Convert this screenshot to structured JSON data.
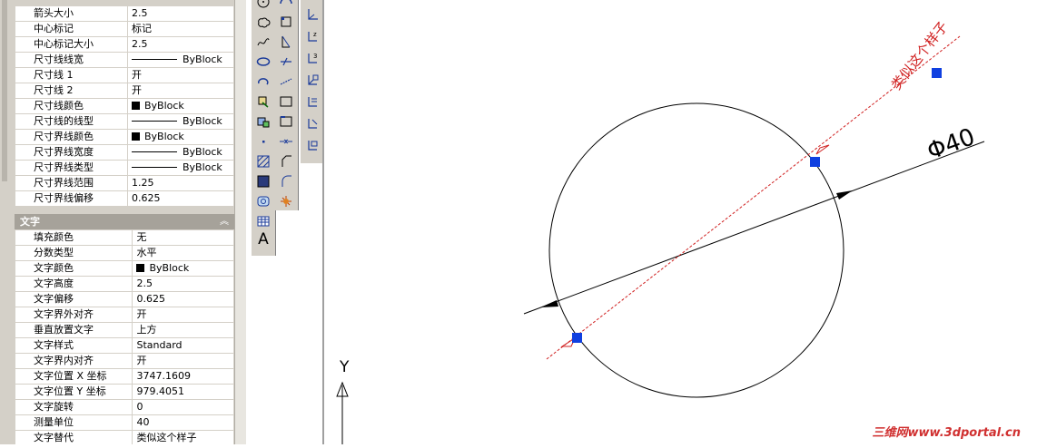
{
  "properties": {
    "group1_rows": [
      {
        "label": "箭头大小",
        "value": "2.5"
      },
      {
        "label": "中心标记",
        "value": "标记"
      },
      {
        "label": "中心标记大小",
        "value": "2.5"
      },
      {
        "label": "尺寸线线宽",
        "value": "ByBlock",
        "kind": "line"
      },
      {
        "label": "尺寸线 1",
        "value": "开"
      },
      {
        "label": "尺寸线 2",
        "value": "开"
      },
      {
        "label": "尺寸线颜色",
        "value": "ByBlock",
        "kind": "swatch"
      },
      {
        "label": "尺寸线的线型",
        "value": "ByBlock",
        "kind": "line"
      },
      {
        "label": "尺寸界线颜色",
        "value": "ByBlock",
        "kind": "swatch"
      },
      {
        "label": "尺寸界线宽度",
        "value": "ByBlock",
        "kind": "line"
      },
      {
        "label": "尺寸界线类型",
        "value": "ByBlock",
        "kind": "line"
      },
      {
        "label": "尺寸界线范围",
        "value": "1.25"
      },
      {
        "label": "尺寸界线偏移",
        "value": "0.625"
      }
    ],
    "text_section_title": "文字",
    "text_rows": [
      {
        "label": "填充颜色",
        "value": "无"
      },
      {
        "label": "分数类型",
        "value": "水平"
      },
      {
        "label": "文字颜色",
        "value": "ByBlock",
        "kind": "swatch"
      },
      {
        "label": "文字高度",
        "value": "2.5"
      },
      {
        "label": "文字偏移",
        "value": "0.625"
      },
      {
        "label": "文字界外对齐",
        "value": "开"
      },
      {
        "label": "垂直放置文字",
        "value": "上方"
      },
      {
        "label": "文字样式",
        "value": "Standard"
      },
      {
        "label": "文字界内对齐",
        "value": "开"
      },
      {
        "label": "文字位置 X 坐标",
        "value": "3747.1609"
      },
      {
        "label": "文字位置 Y 坐标",
        "value": "979.4051"
      },
      {
        "label": "文字旋转",
        "value": "0"
      },
      {
        "label": "测量单位",
        "value": "40"
      },
      {
        "label": "文字替代",
        "value": "类似这个样子"
      }
    ]
  },
  "drawing": {
    "dimension_text": "Φ40",
    "override_text": "类似这个样子",
    "ucs_y_label": "Y",
    "line_color": "#000000",
    "grip_color": "#1040e0",
    "preview_color": "#d02020"
  },
  "watermark": "三维网www.3dportal.cn",
  "icons": {
    "toolbar1": [
      "circle-icon",
      "revision-cloud-icon",
      "spline-icon",
      "ellipse-icon",
      "ellipse-arc-icon",
      "insert-block-icon",
      "make-block-icon",
      "point-icon",
      "hatch-icon",
      "gradient-icon",
      "region-icon",
      "table-icon",
      "multiline-text-icon"
    ],
    "toolbar2": [
      "circle-arc-icon",
      "rectangle-icon",
      "fillet-icon",
      "trim-icon",
      "extend-icon",
      "break-icon",
      "break-at-point-icon",
      "join-icon",
      "chamfer-icon",
      "blend-icon",
      "explode-icon"
    ],
    "toolbar3": [
      "ucs-icon",
      "ucs-z-icon",
      "ucs-3point-icon",
      "dim-linear-icon",
      "dim-aligned-icon",
      "dim-ordinate-icon",
      "dim-radius-icon"
    ]
  },
  "toolbar_text": {
    "text_tool": "A"
  }
}
